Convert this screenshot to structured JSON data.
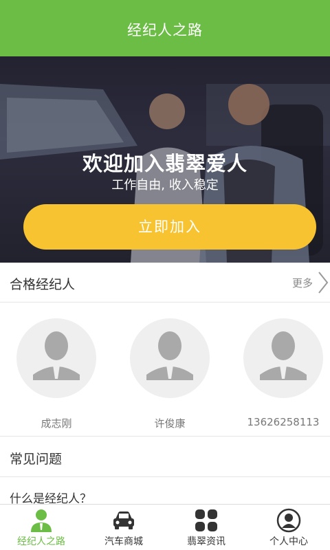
{
  "header": {
    "title": "经纪人之路"
  },
  "banner": {
    "headline": "欢迎加入翡翠爱人",
    "subtitle": "工作自由, 收入稳定",
    "join_label": "立即加入"
  },
  "agents_section": {
    "title": "合格经纪人",
    "more_label": "更多",
    "agents": [
      {
        "name": "成志刚"
      },
      {
        "name": "许俊康"
      },
      {
        "name": "13626258113"
      }
    ]
  },
  "faq": {
    "title": "常见问题",
    "items": [
      {
        "question": "什么是经纪人？"
      }
    ]
  },
  "tabbar": {
    "tabs": [
      {
        "label": "经纪人之路",
        "icon": "agent-user-icon",
        "active": true
      },
      {
        "label": "汽车商城",
        "icon": "car-icon",
        "active": false
      },
      {
        "label": "翡翠资讯",
        "icon": "grid-icon",
        "active": false
      },
      {
        "label": "个人中心",
        "icon": "user-circle-icon",
        "active": false
      }
    ]
  },
  "colors": {
    "brand_green": "#6cbd45",
    "join_yellow": "#f7c331",
    "text_dark": "#333333",
    "text_muted": "#777777"
  }
}
